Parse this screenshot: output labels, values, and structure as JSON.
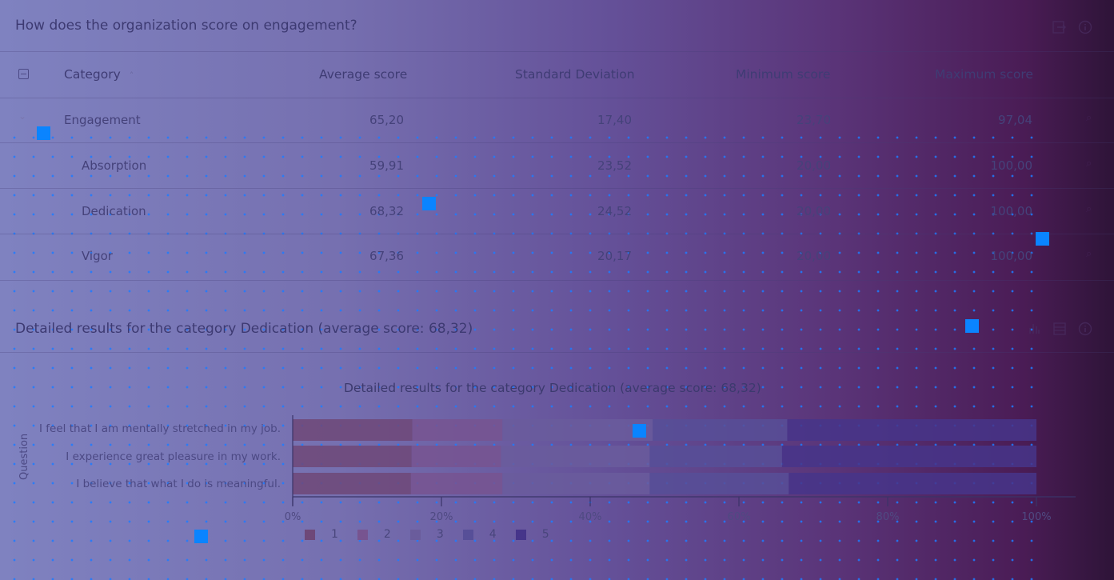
{
  "panel1": {
    "title": "How does the organization score on engagement?",
    "icons": [
      "export-icon",
      "info-icon"
    ],
    "table": {
      "columns": [
        "Category",
        "Average score",
        "Standard Deviation",
        "Minimum score",
        "Maximum score"
      ],
      "sort": {
        "column": "Category",
        "direction": "ascending"
      },
      "rows": [
        {
          "category": "Engagement",
          "level": 0,
          "expanded": true,
          "average": "65,20",
          "std": "17,40",
          "min": "23,70",
          "max": "97,04"
        },
        {
          "category": "Absorption",
          "level": 1,
          "average": "59,91",
          "std": "23,52",
          "min": "20,00",
          "max": "100,00"
        },
        {
          "category": "Dedication",
          "level": 1,
          "average": "68,32",
          "std": "24,52",
          "min": "20,00",
          "max": "100,00"
        },
        {
          "category": "Vigor",
          "level": 1,
          "average": "67,36",
          "std": "20,17",
          "min": "20,00",
          "max": "100,00"
        }
      ]
    }
  },
  "panel2": {
    "title": "Detailed results for the category Dedication (average score: 68,32)",
    "icons": [
      "chart-type-icon",
      "table-view-icon",
      "info-icon"
    ]
  },
  "chart_data": {
    "type": "bar",
    "orientation": "horizontal",
    "stacked": true,
    "title": "Detailed results for the category Dedication (average score: 68,32)",
    "xlabel": "",
    "ylabel": "Question",
    "xlim": [
      0,
      100
    ],
    "x_ticks": [
      "0%",
      "20%",
      "40%",
      "60%",
      "80%",
      "100%"
    ],
    "categories": [
      "I feel that I am mentally stretched in my job.",
      "I experience great pleasure in my work.",
      "I believe that what I do is meaningful."
    ],
    "series": [
      {
        "name": "1",
        "color": "#6e4878",
        "values": [
          16.1,
          16.0,
          15.9
        ]
      },
      {
        "name": "2",
        "color": "#775490",
        "values": [
          12.1,
          12.0,
          12.3
        ]
      },
      {
        "name": "3",
        "color": "#6a5c9c",
        "values": [
          20.2,
          20.0,
          19.8
        ]
      },
      {
        "name": "4",
        "color": "#574f98",
        "values": [
          18.1,
          17.8,
          18.7
        ]
      },
      {
        "name": "5",
        "color": "#46358a",
        "values": [
          33.5,
          34.2,
          33.3
        ]
      }
    ],
    "legend_position": "bottom-left",
    "grid": false
  },
  "overlay": {
    "marker_color": "#0a84ff"
  }
}
